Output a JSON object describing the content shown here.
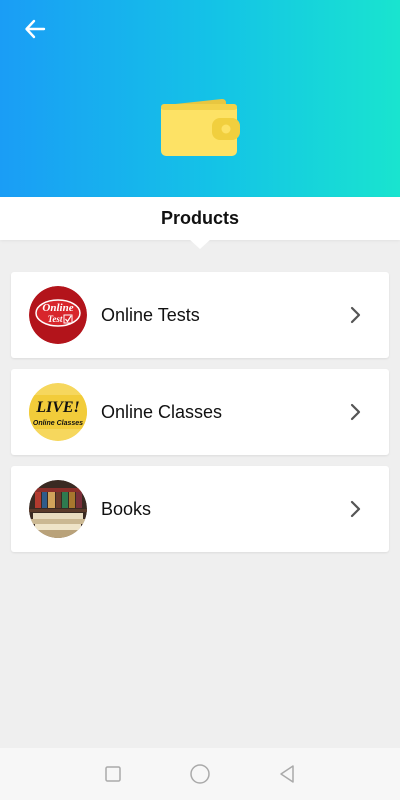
{
  "header": {
    "back_icon": "arrow-left-icon",
    "hero_icon": "wallet-icon"
  },
  "page": {
    "title": "Products"
  },
  "products": [
    {
      "label": "Online Tests",
      "thumb_text_1": "Online",
      "thumb_text_2": "Test",
      "icon": "chevron-right-icon"
    },
    {
      "label": "Online Classes",
      "thumb_text_1": "LIVE!",
      "thumb_text_2": "Online Classes",
      "icon": "chevron-right-icon"
    },
    {
      "label": "Books",
      "icon": "chevron-right-icon"
    }
  ],
  "navbar": {
    "recent_icon": "square-icon",
    "home_icon": "circle-icon",
    "back_icon": "triangle-back-icon"
  }
}
